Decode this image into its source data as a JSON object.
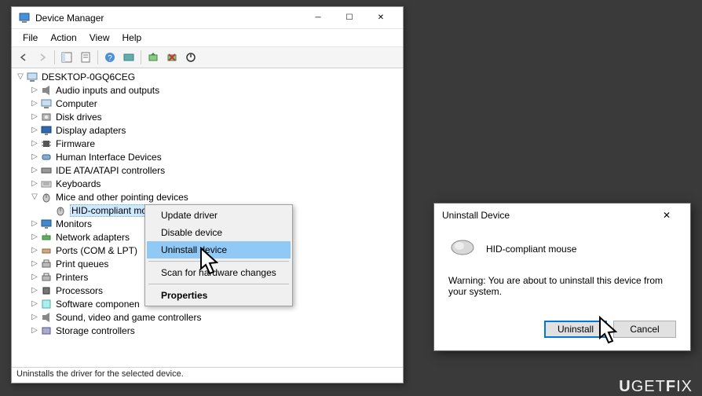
{
  "main_window": {
    "title": "Device Manager",
    "menu": {
      "file": "File",
      "action": "Action",
      "view": "View",
      "help": "Help"
    },
    "status": "Uninstalls the driver for the selected device."
  },
  "tree": {
    "root": "DESKTOP-0GQ6CEG",
    "items": [
      {
        "label": "Audio inputs and outputs",
        "indent": 1,
        "exp": "▷",
        "icon": "speaker"
      },
      {
        "label": "Computer",
        "indent": 1,
        "exp": "▷",
        "icon": "computer"
      },
      {
        "label": "Disk drives",
        "indent": 1,
        "exp": "▷",
        "icon": "disk"
      },
      {
        "label": "Display adapters",
        "indent": 1,
        "exp": "▷",
        "icon": "display"
      },
      {
        "label": "Firmware",
        "indent": 1,
        "exp": "▷",
        "icon": "chip"
      },
      {
        "label": "Human Interface Devices",
        "indent": 1,
        "exp": "▷",
        "icon": "hid"
      },
      {
        "label": "IDE ATA/ATAPI controllers",
        "indent": 1,
        "exp": "▷",
        "icon": "ide"
      },
      {
        "label": "Keyboards",
        "indent": 1,
        "exp": "▷",
        "icon": "keyboard"
      },
      {
        "label": "Mice and other pointing devices",
        "indent": 1,
        "exp": "▽",
        "icon": "mouse"
      },
      {
        "label": "HID-compliant mouse",
        "indent": 2,
        "exp": "",
        "icon": "mouse",
        "selected": true
      },
      {
        "label": "Monitors",
        "indent": 1,
        "exp": "▷",
        "icon": "monitor"
      },
      {
        "label": "Network adapters",
        "indent": 1,
        "exp": "▷",
        "icon": "network"
      },
      {
        "label": "Ports (COM & LPT)",
        "indent": 1,
        "exp": "▷",
        "icon": "port"
      },
      {
        "label": "Print queues",
        "indent": 1,
        "exp": "▷",
        "icon": "printer"
      },
      {
        "label": "Printers",
        "indent": 1,
        "exp": "▷",
        "icon": "printer"
      },
      {
        "label": "Processors",
        "indent": 1,
        "exp": "▷",
        "icon": "cpu"
      },
      {
        "label": "Software componen",
        "indent": 1,
        "exp": "▷",
        "icon": "sw"
      },
      {
        "label": "Sound, video and game controllers",
        "indent": 1,
        "exp": "▷",
        "icon": "sound"
      },
      {
        "label": "Storage controllers",
        "indent": 1,
        "exp": "▷",
        "icon": "storage"
      }
    ]
  },
  "context_menu": {
    "update": "Update driver",
    "disable": "Disable device",
    "uninstall": "Uninstall device",
    "scan": "Scan for hardware changes",
    "properties": "Properties"
  },
  "dialog": {
    "title": "Uninstall Device",
    "device": "HID-compliant mouse",
    "warning": "Warning: You are about to uninstall this device from your system.",
    "uninstall": "Uninstall",
    "cancel": "Cancel"
  },
  "watermark": "UGETFIX"
}
